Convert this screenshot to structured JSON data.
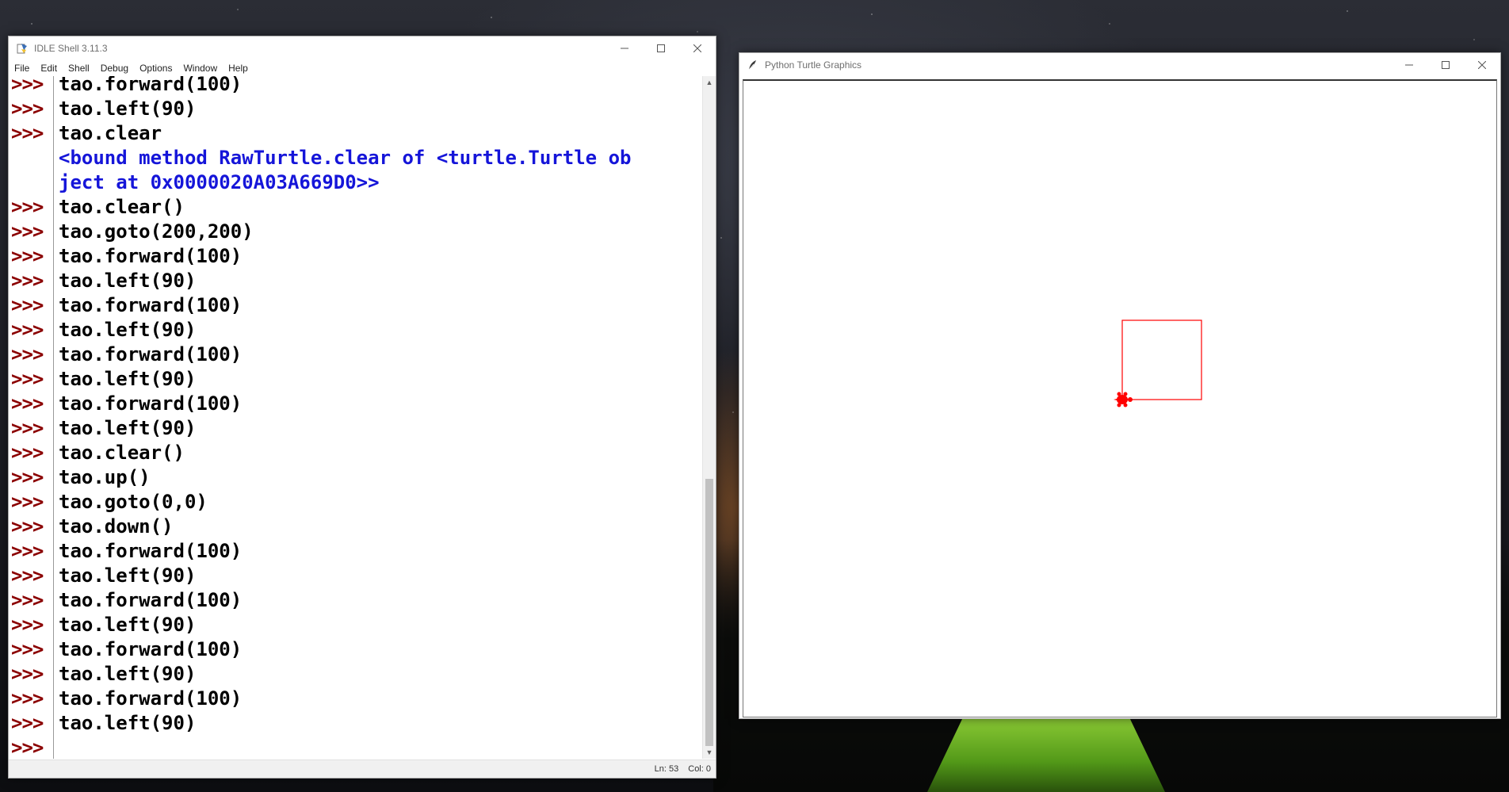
{
  "idle": {
    "title": "IDLE Shell 3.11.3",
    "menu": [
      "File",
      "Edit",
      "Shell",
      "Debug",
      "Options",
      "Window",
      "Help"
    ],
    "prompt": ">>>",
    "lines": [
      {
        "type": "input",
        "text": "tao.forward(100)"
      },
      {
        "type": "input",
        "text": "tao.left(90)"
      },
      {
        "type": "input",
        "text": "tao.clear"
      },
      {
        "type": "output",
        "text": "<bound method RawTurtle.clear of <turtle.Turtle ob"
      },
      {
        "type": "output",
        "text": "ject at 0x0000020A03A669D0>>"
      },
      {
        "type": "input",
        "text": "tao.clear()"
      },
      {
        "type": "input",
        "text": "tao.goto(200,200)"
      },
      {
        "type": "input",
        "text": "tao.forward(100)"
      },
      {
        "type": "input",
        "text": "tao.left(90)"
      },
      {
        "type": "input",
        "text": "tao.forward(100)"
      },
      {
        "type": "input",
        "text": "tao.left(90)"
      },
      {
        "type": "input",
        "text": "tao.forward(100)"
      },
      {
        "type": "input",
        "text": "tao.left(90)"
      },
      {
        "type": "input",
        "text": "tao.forward(100)"
      },
      {
        "type": "input",
        "text": "tao.left(90)"
      },
      {
        "type": "input",
        "text": "tao.clear()"
      },
      {
        "type": "input",
        "text": "tao.up()"
      },
      {
        "type": "input",
        "text": "tao.goto(0,0)"
      },
      {
        "type": "input",
        "text": "tao.down()"
      },
      {
        "type": "input",
        "text": "tao.forward(100)"
      },
      {
        "type": "input",
        "text": "tao.left(90)"
      },
      {
        "type": "input",
        "text": "tao.forward(100)"
      },
      {
        "type": "input",
        "text": "tao.left(90)"
      },
      {
        "type": "input",
        "text": "tao.forward(100)"
      },
      {
        "type": "input",
        "text": "tao.left(90)"
      },
      {
        "type": "input",
        "text": "tao.forward(100)"
      },
      {
        "type": "input",
        "text": "tao.left(90)"
      },
      {
        "type": "input",
        "text": ""
      }
    ],
    "status": {
      "ln": "Ln: 53",
      "col": "Col: 0"
    },
    "colors": {
      "prompt": "#8b0000",
      "output": "#1515d9",
      "code": "#000000"
    }
  },
  "turtle_window": {
    "title": "Python Turtle Graphics",
    "drawing": {
      "shape": "square",
      "side": 100,
      "pen_color": "#ff0000",
      "turtle_color": "#ff0000",
      "turtle_heading_degrees": 0
    }
  }
}
